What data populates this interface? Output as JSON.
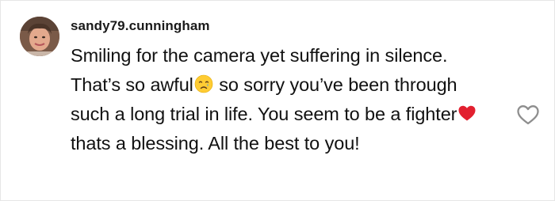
{
  "comment": {
    "username": "sandy79.cunningham",
    "avatar_icon": "user-avatar-photo",
    "text_parts": [
      "Smiling for the camera yet suffering in silence. That’s so awful",
      " so sorry you’ve been through such a long trial in life. You seem to be a fighter",
      "thats a blessing. All the best to you!"
    ],
    "emoji_1": "crying-face-emoji",
    "emoji_2": "red-heart-emoji",
    "like_icon": "heart-outline-icon"
  },
  "colors": {
    "text": "#111111",
    "like_icon": "#8e8e8e",
    "heart_emoji": "#e2202f",
    "crying_face": "#ffcc33"
  }
}
